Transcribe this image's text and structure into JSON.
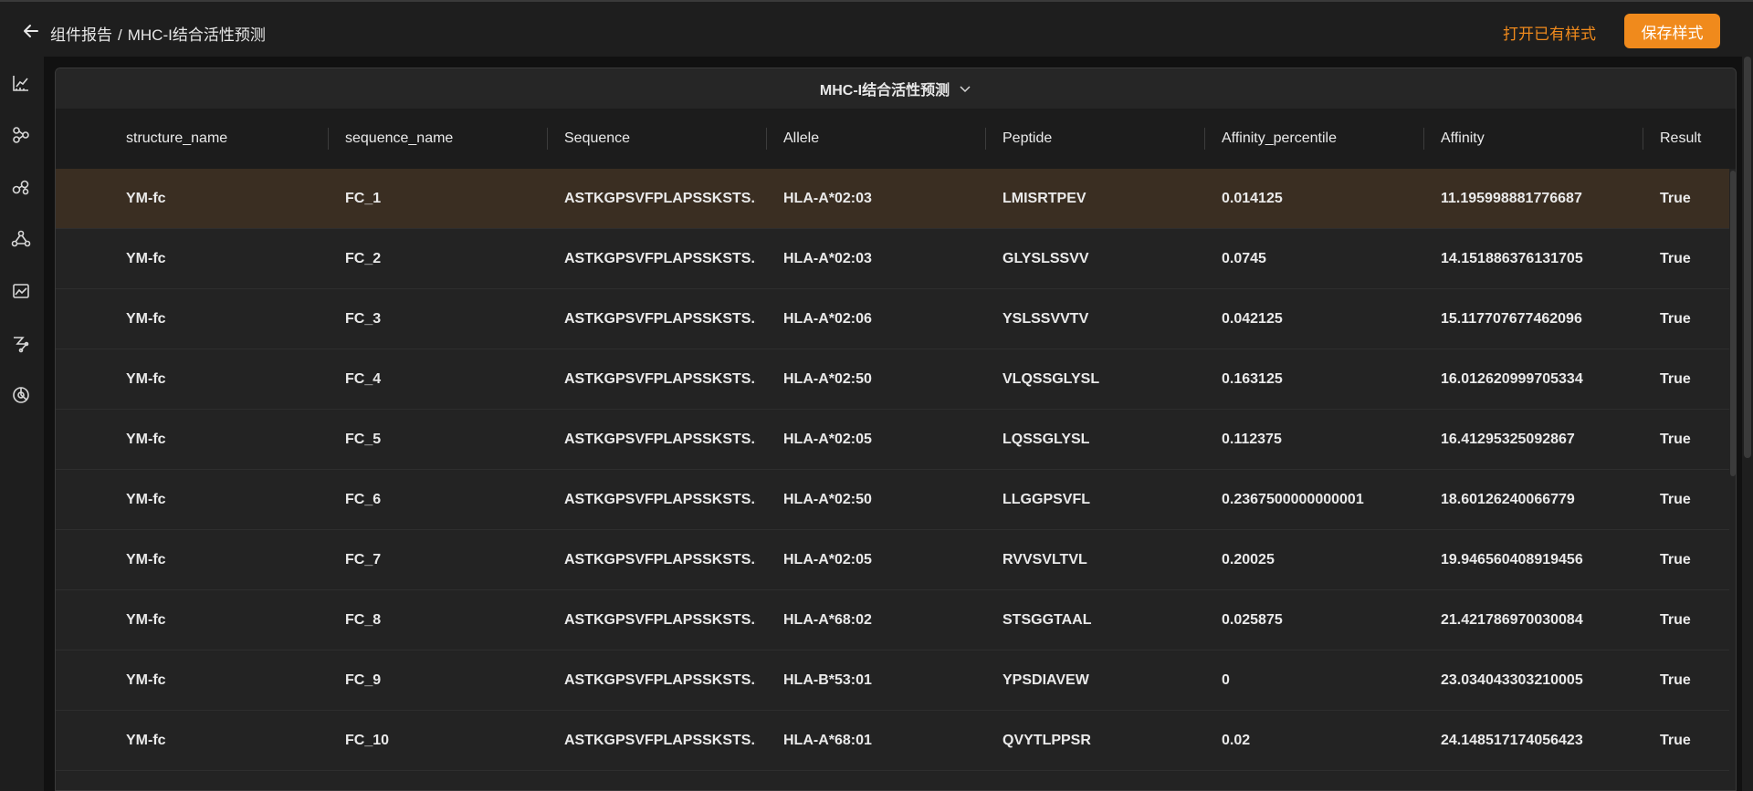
{
  "header": {
    "breadcrumb_parent": "组件报告",
    "breadcrumb_separator": "/",
    "breadcrumb_current": "MHC-I结合活性预测",
    "open_style_label": "打开已有样式",
    "save_style_label": "保存样式"
  },
  "sidebar": {
    "icons": [
      "line-chart-icon",
      "scatter-nodes-icon",
      "molecule-icon",
      "network-triangle-icon",
      "image-chart-icon",
      "route-nodes-icon",
      "pie-chart-icon"
    ]
  },
  "panel": {
    "title": "MHC-I结合活性预测"
  },
  "table": {
    "columns": [
      "structure_name",
      "sequence_name",
      "Sequence",
      "Allele",
      "Peptide",
      "Affinity_percentile",
      "Affinity",
      "Result"
    ],
    "rows": [
      [
        "YM-fc",
        "FC_1",
        "ASTKGPSVFPLAPSSKSTS...",
        "HLA-A*02:03",
        "LMISRTPEV",
        "0.014125",
        "11.195998881776687",
        "True"
      ],
      [
        "YM-fc",
        "FC_2",
        "ASTKGPSVFPLAPSSKSTS...",
        "HLA-A*02:03",
        "GLYSLSSVV",
        "0.0745",
        "14.151886376131705",
        "True"
      ],
      [
        "YM-fc",
        "FC_3",
        "ASTKGPSVFPLAPSSKSTS...",
        "HLA-A*02:06",
        "YSLSSVVTV",
        "0.042125",
        "15.117707677462096",
        "True"
      ],
      [
        "YM-fc",
        "FC_4",
        "ASTKGPSVFPLAPSSKSTS...",
        "HLA-A*02:50",
        "VLQSSGLYSL",
        "0.163125",
        "16.012620999705334",
        "True"
      ],
      [
        "YM-fc",
        "FC_5",
        "ASTKGPSVFPLAPSSKSTS...",
        "HLA-A*02:05",
        "LQSSGLYSL",
        "0.112375",
        "16.41295325092867",
        "True"
      ],
      [
        "YM-fc",
        "FC_6",
        "ASTKGPSVFPLAPSSKSTS...",
        "HLA-A*02:50",
        "LLGGPSVFL",
        "0.2367500000000001",
        "18.60126240066779",
        "True"
      ],
      [
        "YM-fc",
        "FC_7",
        "ASTKGPSVFPLAPSSKSTS...",
        "HLA-A*02:05",
        "RVVSVLTVL",
        "0.20025",
        "19.946560408919456",
        "True"
      ],
      [
        "YM-fc",
        "FC_8",
        "ASTKGPSVFPLAPSSKSTS...",
        "HLA-A*68:02",
        "STSGGTAAL",
        "0.025875",
        "21.421786970030084",
        "True"
      ],
      [
        "YM-fc",
        "FC_9",
        "ASTKGPSVFPLAPSSKSTS...",
        "HLA-B*53:01",
        "YPSDIAVEW",
        "0",
        "23.034043303210005",
        "True"
      ],
      [
        "YM-fc",
        "FC_10",
        "ASTKGPSVFPLAPSSKSTS...",
        "HLA-A*68:01",
        "QVYTLPPSR",
        "0.02",
        "24.148517174056423",
        "True"
      ]
    ],
    "selected_row": 0
  },
  "colors": {
    "accent": "#f08a1c",
    "background": "#1e1e1e",
    "panel": "#232323",
    "selected_row": "#3a2e22"
  }
}
